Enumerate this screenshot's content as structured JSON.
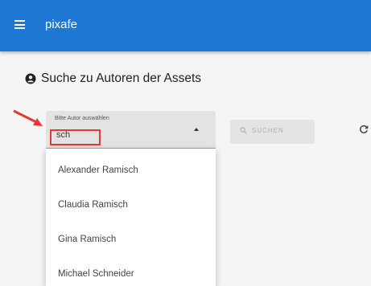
{
  "app": {
    "title": "pixafe"
  },
  "page": {
    "heading": "Suche zu Autoren der Assets"
  },
  "author_select": {
    "label": "Bitte Autor auswählen",
    "value": "sch"
  },
  "search_button": {
    "label": "SUCHEN"
  },
  "dropdown": {
    "options": [
      {
        "label": "Alexander Ramisch"
      },
      {
        "label": "Claudia Ramisch"
      },
      {
        "label": "Gina Ramisch"
      },
      {
        "label": "Michael Schneider"
      }
    ]
  },
  "colors": {
    "appbar": "#1e77d3",
    "highlight": "#e53935",
    "arrow": "#e53935"
  },
  "icons": {
    "menu": "menu-icon",
    "heading": "user-circle-icon",
    "search": "search-icon",
    "refresh": "refresh-icon",
    "select": "chevron-up-icon"
  }
}
